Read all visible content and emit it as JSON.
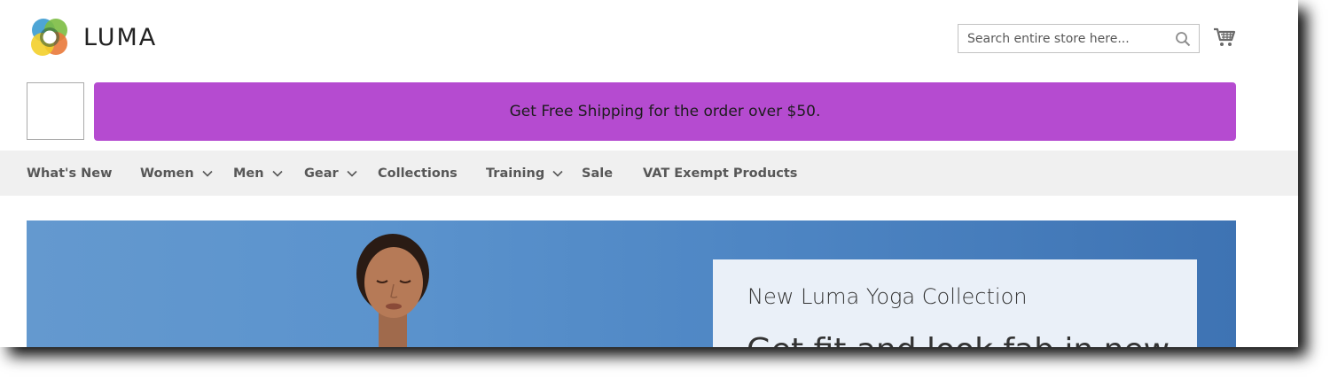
{
  "header": {
    "brand": "LUMA",
    "search_placeholder": "Search entire store here...",
    "search_icon": "magnifier-icon",
    "cart_icon": "shopping-cart-icon"
  },
  "promo": {
    "text": "Get Free Shipping for the order over $50.",
    "color": "#b54bd0"
  },
  "nav": {
    "items": [
      {
        "label": "What's New",
        "has_dropdown": false
      },
      {
        "label": "Women",
        "has_dropdown": true
      },
      {
        "label": "Men",
        "has_dropdown": true
      },
      {
        "label": "Gear",
        "has_dropdown": true
      },
      {
        "label": "Collections",
        "has_dropdown": false
      },
      {
        "label": "Training",
        "has_dropdown": true
      },
      {
        "label": "Sale",
        "has_dropdown": false
      },
      {
        "label": "VAT Exempt Products",
        "has_dropdown": false
      }
    ]
  },
  "hero": {
    "title": "New Luma Yoga Collection",
    "headline": "Get fit and look fab in new"
  }
}
